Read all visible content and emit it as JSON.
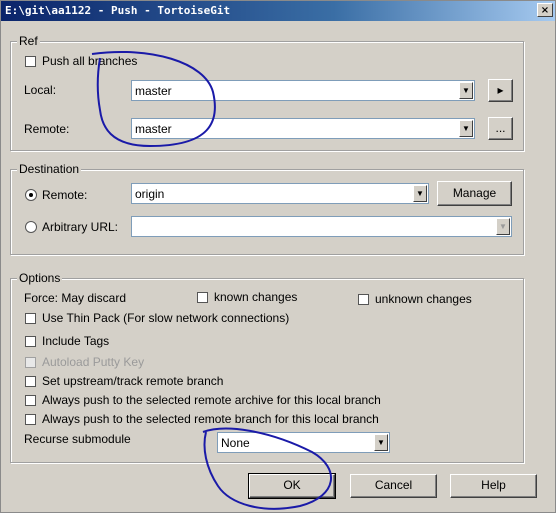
{
  "window": {
    "title": "E:\\git\\aa1122 - Push - TortoiseGit",
    "close_glyph": "×"
  },
  "ref": {
    "legend": "Ref",
    "push_all_branches": "Push all branches",
    "local_label": "Local:",
    "local_value": "master",
    "local_button_glyph": "▸",
    "remote_label": "Remote:",
    "remote_value": "master",
    "remote_button_glyph": "..."
  },
  "destination": {
    "legend": "Destination",
    "remote_label": "Remote:",
    "remote_value": "origin",
    "manage_label": "Manage",
    "arbitrary_url_label": "Arbitrary URL:",
    "arbitrary_url_value": ""
  },
  "options": {
    "legend": "Options",
    "force_label": "Force: May discard",
    "known_changes": "known changes",
    "unknown_changes": "unknown changes",
    "thin_pack": "Use Thin Pack (For slow network connections)",
    "include_tags": "Include Tags",
    "autoload_putty": "Autoload Putty Key",
    "set_upstream": "Set upstream/track remote branch",
    "always_push_archive": "Always push to the selected remote archive for this local branch",
    "always_push_branch": "Always push to the selected remote branch for this local branch",
    "recurse_label": "Recurse submodule",
    "recurse_value": "None"
  },
  "buttons": {
    "ok": "OK",
    "cancel": "Cancel",
    "help": "Help"
  },
  "icons": {
    "dropdown": "▼"
  },
  "annotation_color": "#1a1aa8"
}
